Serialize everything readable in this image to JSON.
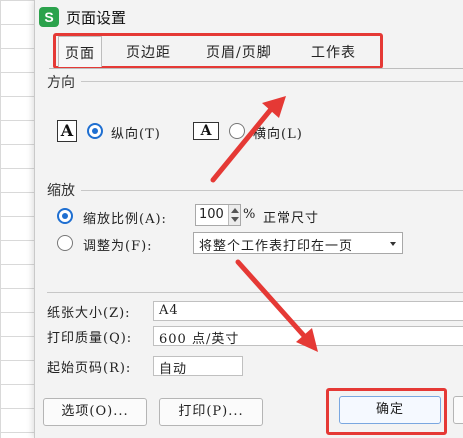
{
  "dialog": {
    "title": "页面设置",
    "app_icon_letter": "S"
  },
  "tabs": [
    {
      "label": "页面"
    },
    {
      "label": "页边距"
    },
    {
      "label": "页眉/页脚"
    },
    {
      "label": "工作表"
    }
  ],
  "orientation": {
    "section_label": "方向",
    "portrait_icon_letter": "A",
    "portrait_label": "纵向(T)",
    "landscape_icon_letter": "A",
    "landscape_label": "横向(L)"
  },
  "scaling": {
    "section_label": "缩放",
    "scale_label": "缩放比例(A):",
    "scale_value": "100",
    "percent": "%",
    "scale_hint": "正常尺寸",
    "fit_label": "调整为(F):",
    "fit_option": "将整个工作表打印在一页"
  },
  "paper": {
    "size_label": "纸张大小(Z):",
    "size_value": "A4",
    "quality_label": "打印质量(Q):",
    "quality_value": "600 点/英寸",
    "first_page_label": "起始页码(R):",
    "first_page_value": "自动"
  },
  "buttons": {
    "options": "选项(O)...",
    "print": "打印(P)...",
    "ok": "确定"
  },
  "colors": {
    "annotation": "#e53935",
    "accent": "#1f6fd1",
    "app_icon": "#2ba24c"
  }
}
